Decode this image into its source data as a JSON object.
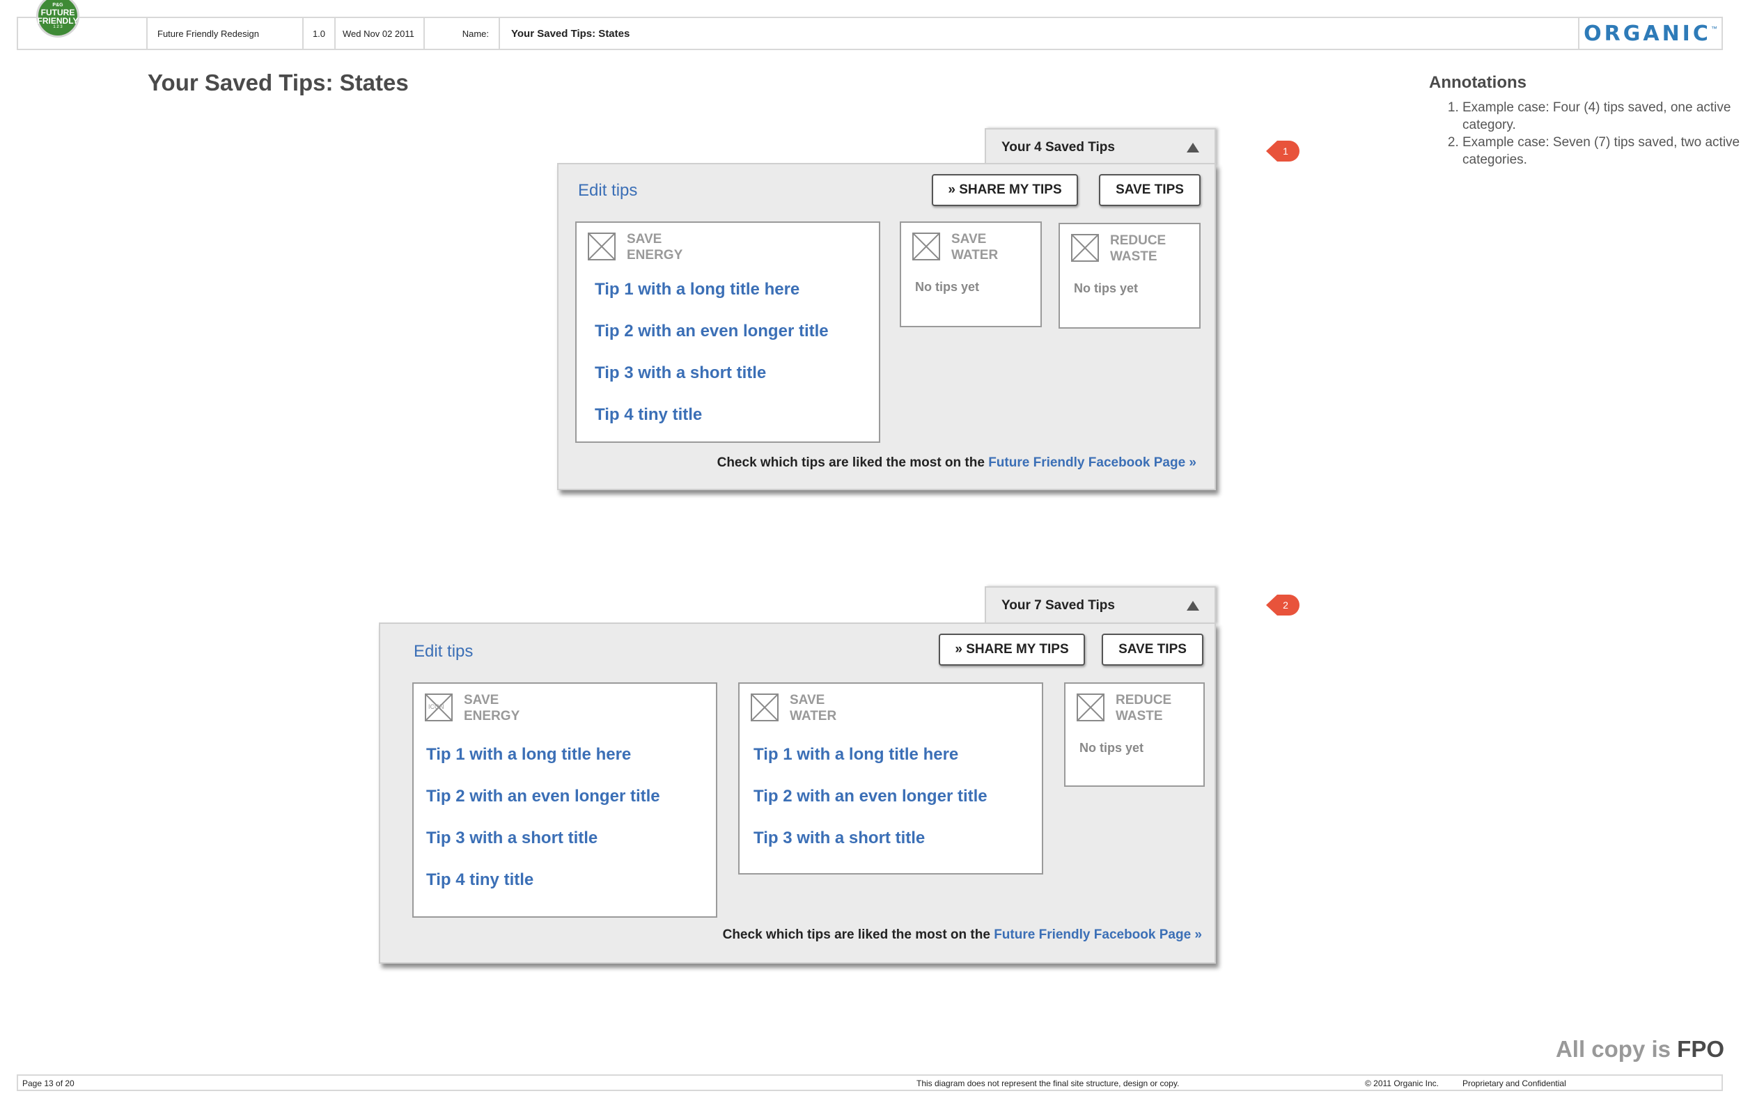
{
  "header": {
    "logo": {
      "line1": "P&G",
      "line2": "FUTURE",
      "line3": "FRIENDLY",
      "tag": "1 2 3"
    },
    "project": "Future Friendly Redesign",
    "version": "1.0",
    "date": "Wed Nov 02 2011",
    "name_label": "Name:",
    "name_value": "Your Saved Tips: States",
    "brand": "ORGANIC",
    "brand_mark": "™"
  },
  "page_title": "Your Saved Tips: States",
  "annotations": {
    "title": "Annotations",
    "items": [
      "Example case: Four (4) tips saved, one active category.",
      "Example case: Seven (7) tips saved, two active categories."
    ]
  },
  "panel1": {
    "tab_label": "Your 4 Saved Tips",
    "marker": "1",
    "edit_tips": "Edit tips",
    "share_button": "» SHARE MY TIPS",
    "save_button": "SAVE TIPS",
    "categories": [
      {
        "label1": "SAVE",
        "label2": "ENERGY",
        "tips": [
          "Tip 1 with a long title here",
          "Tip 2 with an even longer title",
          "Tip 3 with a short title",
          "Tip 4 tiny title"
        ]
      },
      {
        "label1": "SAVE",
        "label2": "WATER",
        "empty": "No tips yet"
      },
      {
        "label1": "REDUCE",
        "label2": "WASTE",
        "empty": "No tips yet"
      }
    ],
    "fb_text": "Check which tips are liked the most on the ",
    "fb_link": "Future Friendly Facebook Page »"
  },
  "panel2": {
    "tab_label": "Your 7 Saved Tips",
    "marker": "2",
    "edit_tips": "Edit tips",
    "share_button": "» SHARE MY TIPS",
    "save_button": "SAVE TIPS",
    "categories": [
      {
        "label1": "SAVE",
        "label2": "ENERGY",
        "icon_text": "ICON",
        "tips": [
          "Tip 1 with a long title here",
          "Tip 2 with an even longer title",
          "Tip 3 with a short title",
          "Tip 4 tiny title"
        ]
      },
      {
        "label1": "SAVE",
        "label2": "WATER",
        "tips": [
          "Tip 1 with a long title here",
          "Tip 2 with an even longer title",
          "Tip 3 with a short title"
        ]
      },
      {
        "label1": "REDUCE",
        "label2": "WASTE",
        "empty": "No tips yet"
      }
    ],
    "fb_text": "Check which tips are liked the most on the ",
    "fb_link": "Future Friendly Facebook Page »"
  },
  "footer": {
    "fpo_prefix": "All copy is ",
    "fpo_bold": "FPO",
    "page": "Page 13 of 20",
    "disclaimer": "This diagram does not represent the final site structure, design or copy.",
    "copyright": "© 2011 Organic Inc.",
    "confidential": "Proprietary and Confidential"
  },
  "colors": {
    "accent_blue": "#3b6fb6",
    "marker_red": "#e8533b",
    "logo_green": "#3f8a36",
    "brand_blue": "#2e7bb8"
  }
}
